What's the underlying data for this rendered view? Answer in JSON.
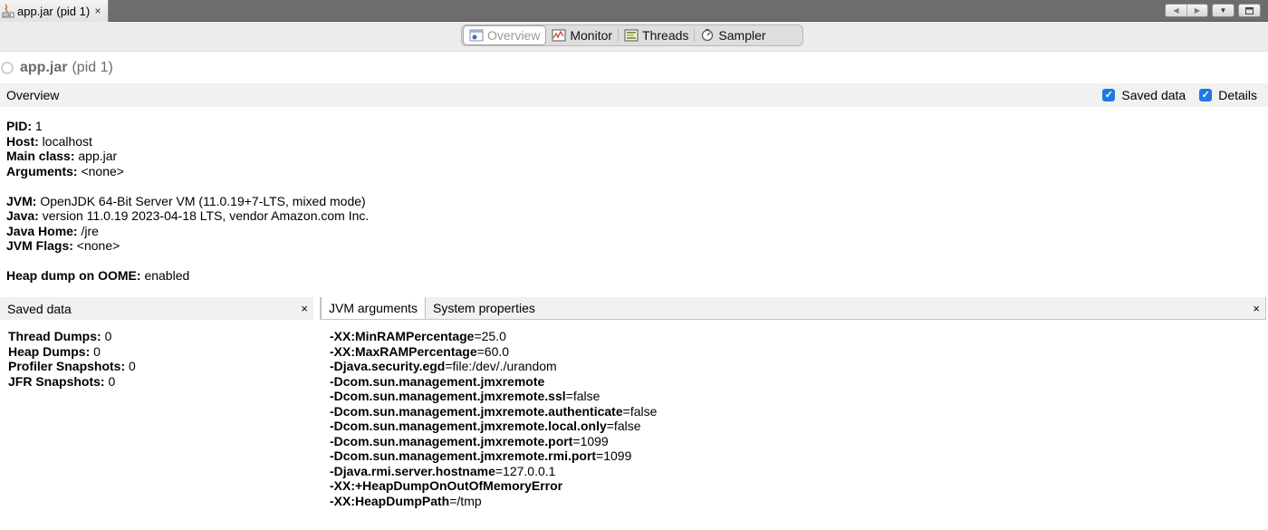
{
  "document_tab": {
    "title": "app.jar (pid 1)",
    "close": "×"
  },
  "toolbar": {
    "tabs": [
      {
        "label": "Overview",
        "icon": "overview-icon",
        "active": true
      },
      {
        "label": "Monitor",
        "icon": "monitor-icon"
      },
      {
        "label": "Threads",
        "icon": "threads-icon"
      },
      {
        "label": "Sampler",
        "icon": "sampler-icon"
      }
    ]
  },
  "heading": {
    "app": "app.jar",
    "pid": "(pid 1)"
  },
  "overview_bar": {
    "label": "Overview",
    "saved_data": "Saved data",
    "details": "Details"
  },
  "info": {
    "pid_label": "PID:",
    "pid_value": " 1",
    "host_label": "Host:",
    "host_value": " localhost",
    "main_label": "Main class:",
    "main_value": " app.jar",
    "args_label": "Arguments:",
    "args_value": " <none>",
    "jvm_label": "JVM:",
    "jvm_value": " OpenJDK 64-Bit Server VM (11.0.19+7-LTS, mixed mode)",
    "java_label": "Java:",
    "java_value": " version 11.0.19 2023-04-18 LTS, vendor Amazon.com Inc.",
    "javahome_label": "Java Home:",
    "javahome_value": " /jre",
    "flags_label": "JVM Flags:",
    "flags_value": " <none>",
    "heap_label": "Heap dump on OOME:",
    "heap_value": " enabled"
  },
  "saved_panel": {
    "title": "Saved data",
    "close": "×",
    "items": [
      {
        "label": "Thread Dumps:",
        "value": " 0"
      },
      {
        "label": "Heap Dumps:",
        "value": " 0"
      },
      {
        "label": "Profiler Snapshots:",
        "value": " 0"
      },
      {
        "label": "JFR Snapshots:",
        "value": " 0"
      }
    ]
  },
  "args_panel": {
    "tabs": [
      "JVM arguments",
      "System properties"
    ],
    "close": "×",
    "args": [
      {
        "name": "-XX:MinRAMPercentage",
        "value": "=25.0"
      },
      {
        "name": "-XX:MaxRAMPercentage",
        "value": "=60.0"
      },
      {
        "name": "-Djava.security.egd",
        "value": "=file:/dev/./urandom"
      },
      {
        "name": "-Dcom.sun.management.jmxremote",
        "value": ""
      },
      {
        "name": "-Dcom.sun.management.jmxremote.ssl",
        "value": "=false"
      },
      {
        "name": "-Dcom.sun.management.jmxremote.authenticate",
        "value": "=false"
      },
      {
        "name": "-Dcom.sun.management.jmxremote.local.only",
        "value": "=false"
      },
      {
        "name": "-Dcom.sun.management.jmxremote.port",
        "value": "=1099"
      },
      {
        "name": "-Dcom.sun.management.jmxremote.rmi.port",
        "value": "=1099"
      },
      {
        "name": "-Djava.rmi.server.hostname",
        "value": "=127.0.0.1"
      },
      {
        "name": "-XX:+HeapDumpOnOutOfMemoryError",
        "value": ""
      },
      {
        "name": "-XX:HeapDumpPath",
        "value": "=/tmp"
      }
    ]
  },
  "colors": {
    "accent": "#1f7ae0",
    "tabstrip": "#6d6d6d",
    "panel": "#f1f1f1"
  }
}
